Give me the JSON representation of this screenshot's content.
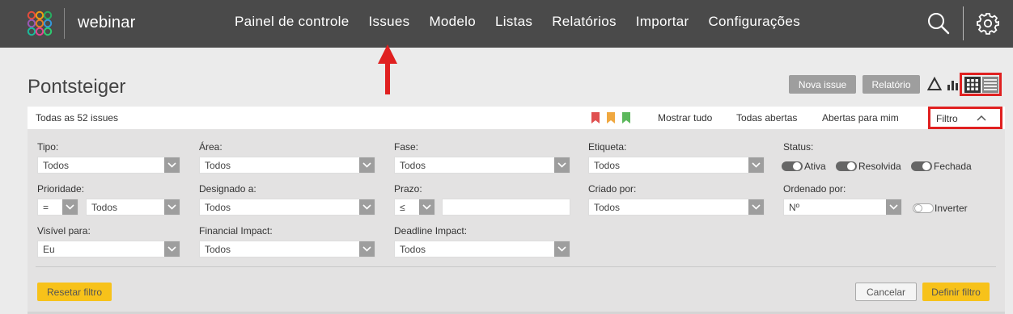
{
  "header": {
    "app_name": "webinar",
    "nav": [
      "Painel de controle",
      "Issues",
      "Modelo",
      "Listas",
      "Relatórios",
      "Importar",
      "Configurações"
    ]
  },
  "page": {
    "title": "Pontsteiger",
    "new_issue_label": "Nova issue",
    "report_label": "Relatório"
  },
  "filter_bar": {
    "count_text": "Todas as 52 issues",
    "show_all": "Mostrar tudo",
    "all_open": "Todas abertas",
    "open_for_me": "Abertas para mim",
    "filter_label": "Filtro",
    "flag_colors": [
      "#e05050",
      "#f0a840",
      "#5cb85c"
    ]
  },
  "filters": {
    "tipo": {
      "label": "Tipo:",
      "value": "Todos"
    },
    "area": {
      "label": "Área:",
      "value": "Todos"
    },
    "fase": {
      "label": "Fase:",
      "value": "Todos"
    },
    "etiqueta": {
      "label": "Etiqueta:",
      "value": "Todos"
    },
    "status": {
      "label": "Status:",
      "options": [
        "Ativa",
        "Resolvida",
        "Fechada"
      ]
    },
    "prioridade": {
      "label": "Prioridade:",
      "operator": "=",
      "value": "Todos"
    },
    "designado": {
      "label": "Designado a:",
      "value": "Todos"
    },
    "prazo": {
      "label": "Prazo:",
      "operator": "≤",
      "value": ""
    },
    "criado": {
      "label": "Criado por:",
      "value": "Todos"
    },
    "ordenado": {
      "label": "Ordenado por:",
      "value": "Nº",
      "invert_label": "Inverter"
    },
    "visivel": {
      "label": "Visível para:",
      "value": "Eu"
    },
    "financial": {
      "label": "Financial Impact:",
      "value": "Todos"
    },
    "deadline": {
      "label": "Deadline Impact:",
      "value": "Todos"
    }
  },
  "actions": {
    "reset": "Resetar filtro",
    "cancel": "Cancelar",
    "apply": "Definir filtro"
  },
  "colors": {
    "topbar": "#4a4a4a",
    "annotation_red": "#e02020",
    "accent_yellow": "#f7c21a"
  }
}
